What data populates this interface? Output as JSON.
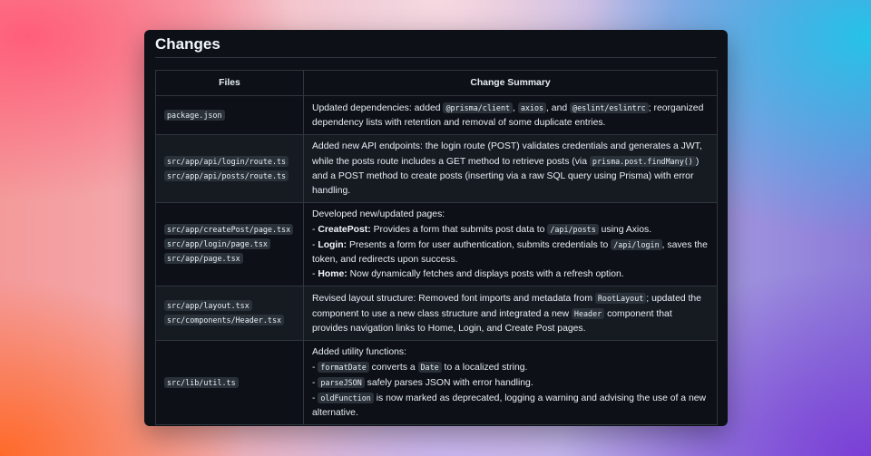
{
  "heading": "Changes",
  "table": {
    "headers": [
      "Files",
      "Change Summary"
    ],
    "rows": [
      {
        "files": [
          "package.json"
        ],
        "summary": {
          "a": "Updated dependencies: added ",
          "c1": "@prisma/client",
          "b": ", ",
          "c2": "axios",
          "c": ", and ",
          "c3": "@eslint/eslintrc",
          "d": "; reorganized dependency lists with retention and removal of some duplicate entries."
        }
      },
      {
        "files": [
          "src/app/api/login/route.ts",
          "src/app/api/posts/route.ts"
        ],
        "summary": {
          "a": "Added new API endpoints: the login route (POST) validates credentials and generates a JWT, while the posts route includes a GET method to retrieve posts (via ",
          "c1": "prisma.post.findMany()",
          "b": ") and a POST method to create posts (inserting via a raw SQL query using Prisma) with error handling."
        }
      },
      {
        "files": [
          "src/app/createPost/page.tsx",
          "src/app/login/page.tsx",
          "src/app/page.tsx"
        ],
        "summary": {
          "intro": "Developed new/updated pages:",
          "l1_strong": "CreatePost:",
          "l1_a": " Provides a form that submits post data to ",
          "l1_code": "/api/posts",
          "l1_b": " using Axios.",
          "l2_strong": "Login:",
          "l2_a": " Presents a form for user authentication, submits credentials to ",
          "l2_code": "/api/login",
          "l2_b": ", saves the token, and redirects upon success.",
          "l3_strong": "Home:",
          "l3_a": " Now dynamically fetches and displays posts with a refresh option."
        }
      },
      {
        "files": [
          "src/app/layout.tsx",
          "src/components/Header.tsx"
        ],
        "summary": {
          "a": "Revised layout structure: Removed font imports and metadata from ",
          "c1": "RootLayout",
          "b": "; updated the component to use a new class structure and integrated a new ",
          "c2": "Header",
          "c": " component that provides navigation links to Home, Login, and Create Post pages."
        }
      },
      {
        "files": [
          "src/lib/util.ts"
        ],
        "summary": {
          "intro": "Added utility functions:",
          "l1_code": "formatDate",
          "l1_a": " converts a ",
          "l1_code2": "Date",
          "l1_b": " to a localized string.",
          "l2_code": "parseJSON",
          "l2_a": " safely parses JSON with error handling.",
          "l3_code": "oldFunction",
          "l3_a": " is now marked as deprecated, logging a warning and advising the use of a new alternative."
        }
      }
    ]
  }
}
